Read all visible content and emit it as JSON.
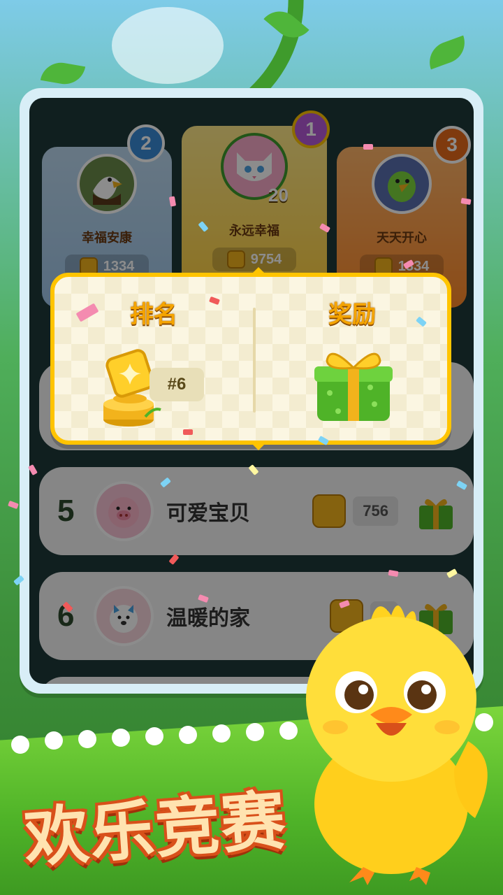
{
  "podium": [
    {
      "rank": "2",
      "name": "幸福安康",
      "score": "1334",
      "avatar": "eagle-avatar",
      "color": "#9fc5e8"
    },
    {
      "rank": "1",
      "name": "永远幸福",
      "score": "9754",
      "level": "20",
      "avatar": "white-cat-avatar",
      "color": "#ffcf3d"
    },
    {
      "rank": "3",
      "name": "天天开心",
      "score": "1334",
      "avatar": "parrot-avatar",
      "color": "#ff8a2a"
    }
  ],
  "popup": {
    "rank_title": "排名",
    "reward_title": "奖励",
    "rank_value": "#6"
  },
  "rows": [
    {
      "rank": "5",
      "name": "可爱宝贝",
      "score": "756",
      "avatar": "pig-avatar"
    },
    {
      "rank": "6",
      "name": "温暖的家",
      "score": "7",
      "avatar": "puppy-avatar"
    }
  ],
  "banner": {
    "title": "欢乐竞赛"
  },
  "colors": {
    "accent": "#ffc400",
    "title": "#f5a400",
    "ground": "#4fb328"
  }
}
